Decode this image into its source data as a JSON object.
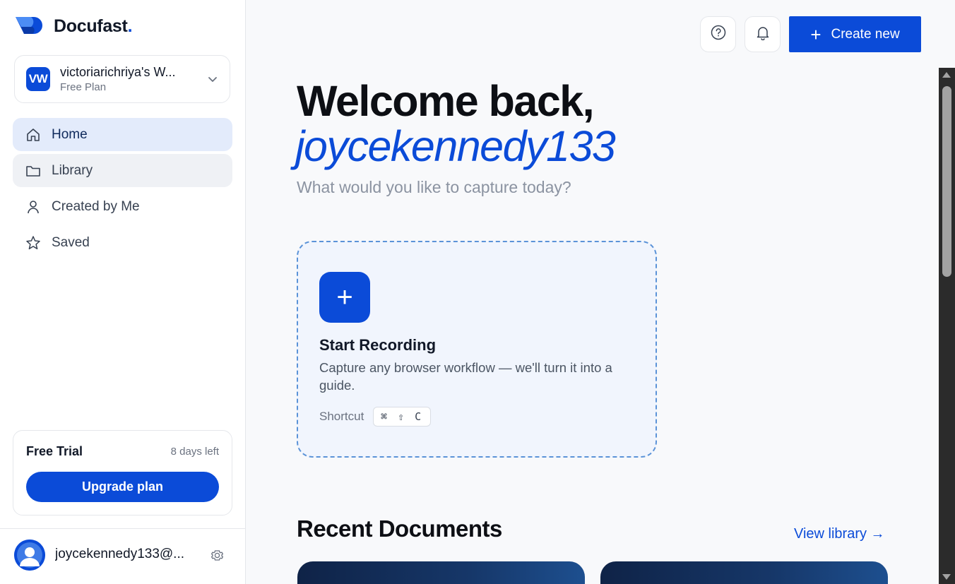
{
  "brand": {
    "name": "Docufast",
    "dot": "."
  },
  "workspace": {
    "initials": "VW",
    "name": "victoriarichriya's W...",
    "plan": "Free Plan"
  },
  "nav": [
    {
      "label": "Home",
      "icon": "home-icon"
    },
    {
      "label": "Library",
      "icon": "folder-icon"
    },
    {
      "label": "Created by Me",
      "icon": "user-icon"
    },
    {
      "label": "Saved",
      "icon": "star-icon"
    }
  ],
  "trial": {
    "title": "Free Trial",
    "days_left": "8 days left",
    "upgrade_label": "Upgrade plan"
  },
  "user": {
    "email": "joycekennedy133@..."
  },
  "header": {
    "create_label": "Create new",
    "help_icon": "help-circle-icon",
    "bell_icon": "bell-icon"
  },
  "hero": {
    "greeting": "Welcome back,",
    "username": "joycekennedy133",
    "subtitle": "What would you like to capture today?"
  },
  "record": {
    "title": "Start Recording",
    "description": "Capture any browser workflow — we'll turn it into a guide.",
    "shortcut_label": "Shortcut",
    "shortcut_keys": "⌘ ⇧ C"
  },
  "recent": {
    "title": "Recent Documents",
    "view_library": "View library →"
  },
  "colors": {
    "accent": "#0b4bd8",
    "active_nav_bg": "#e3ebfb",
    "card_bg": "#f1f5fd",
    "card_border": "#5b93d8"
  }
}
